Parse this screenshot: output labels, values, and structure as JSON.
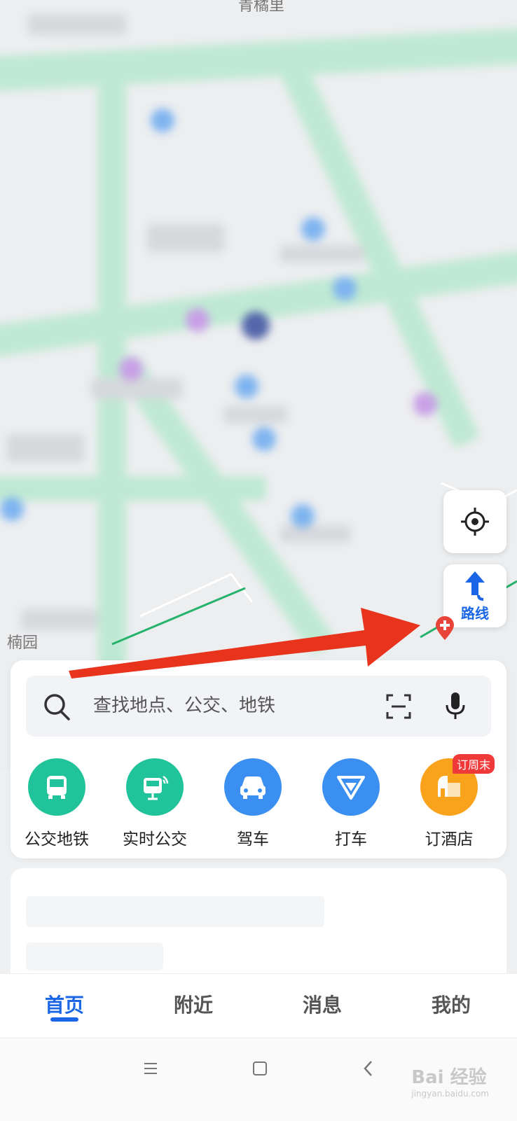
{
  "map": {
    "labels": [
      "青橘里",
      "楠园"
    ]
  },
  "side_buttons": {
    "route_label": "路线"
  },
  "search": {
    "placeholder": "查找地点、公交、地铁"
  },
  "categories": [
    {
      "label": "公交地铁",
      "color": "#21c39a",
      "icon": "bus-icon"
    },
    {
      "label": "实时公交",
      "color": "#21c39a",
      "icon": "realtime-bus-icon"
    },
    {
      "label": "驾车",
      "color": "#3a8ff0",
      "icon": "car-icon"
    },
    {
      "label": "打车",
      "color": "#3a8ff0",
      "icon": "taxi-icon"
    },
    {
      "label": "订酒店",
      "color": "#f9a21b",
      "icon": "hotel-icon",
      "badge": "订周末"
    }
  ],
  "tabs": [
    {
      "label": "首页",
      "active": true
    },
    {
      "label": "附近",
      "active": false
    },
    {
      "label": "消息",
      "active": false
    },
    {
      "label": "我的",
      "active": false
    }
  ],
  "watermark": {
    "brand": "Bai 经验",
    "site": "jingyan.baidu.com"
  },
  "colors": {
    "accent": "#1a66e6",
    "annotation_arrow": "#e8341c"
  }
}
